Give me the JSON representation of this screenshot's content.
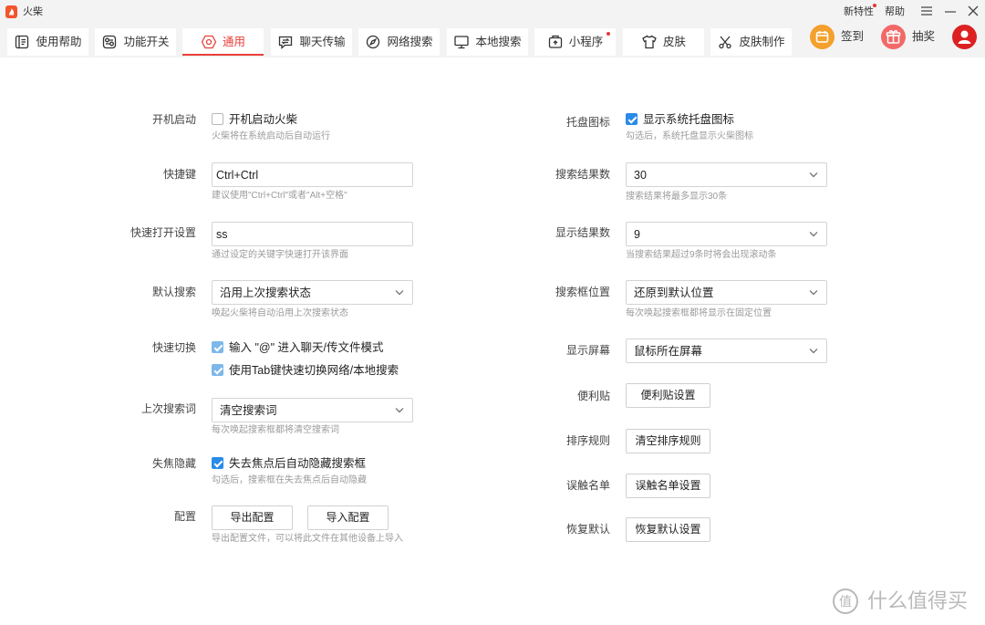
{
  "window": {
    "title": "火柴",
    "logo_icon": "huochai-logo-icon",
    "new_features": "新特性",
    "help": "帮助",
    "menu_icon": "menu-icon",
    "minimize_icon": "minimize-icon",
    "close_icon": "close-icon"
  },
  "tabs": [
    {
      "label": "使用帮助",
      "icon": "help-book-icon",
      "active": false
    },
    {
      "label": "功能开关",
      "icon": "feature-switch-icon",
      "active": false
    },
    {
      "label": "通用",
      "icon": "settings-hexagon-icon",
      "active": true
    },
    {
      "label": "聊天传输",
      "icon": "chat-transfer-icon",
      "active": false
    },
    {
      "label": "网络搜索",
      "icon": "compass-icon",
      "active": false
    },
    {
      "label": "本地搜索",
      "icon": "monitor-icon",
      "active": false
    },
    {
      "label": "小程序",
      "icon": "mini-program-icon",
      "active": false,
      "badge_dot": true
    },
    {
      "label": "皮肤",
      "icon": "tshirt-icon",
      "active": false
    },
    {
      "label": "皮肤制作",
      "icon": "skin-design-icon",
      "active": false
    }
  ],
  "actions": {
    "checkin": {
      "label": "签到",
      "icon": "checkin-icon"
    },
    "lottery": {
      "label": "抽奖",
      "icon": "gift-icon"
    },
    "avatar_icon": "user-avatar-icon"
  },
  "general_left": {
    "autostart": {
      "label": "开机启动",
      "checkbox": "开机启动火柴",
      "checked": false,
      "hint": "火柴将在系统启动后自动运行"
    },
    "hotkey": {
      "label": "快捷键",
      "value": "Ctrl+Ctrl",
      "hint": "建议使用\"Ctrl+Ctrl\"或者\"Alt+空格\""
    },
    "quick_open": {
      "label": "快速打开设置",
      "value": "ss",
      "hint": "通过设定的关键字快速打开该界面"
    },
    "default_search": {
      "label": "默认搜索",
      "selected": "沿用上次搜索状态",
      "hint": "唤起火柴将自动沿用上次搜索状态"
    },
    "quick_switch": {
      "label": "快速切换",
      "options": [
        {
          "text": "输入 \"@\" 进入聊天/传文件模式",
          "checked": true
        },
        {
          "text": "使用Tab键快速切换网络/本地搜索",
          "checked": true
        }
      ]
    },
    "last_query": {
      "label": "上次搜索词",
      "selected": "清空搜索词",
      "hint": "每次唤起搜索框都将清空搜索词"
    },
    "blur_hide": {
      "label": "失焦隐藏",
      "checkbox": "失去焦点后自动隐藏搜索框",
      "checked": true,
      "hint": "勾选后，搜索框在失去焦点后自动隐藏"
    },
    "config": {
      "label": "配置",
      "export_button": "导出配置",
      "import_button": "导入配置",
      "hint": "导出配置文件，可以将此文件在其他设备上导入"
    }
  },
  "general_right": {
    "tray_icon": {
      "label": "托盘图标",
      "checkbox": "显示系统托盘图标",
      "checked": true,
      "hint": "勾选后，系统托盘显示火柴图标"
    },
    "result_count": {
      "label": "搜索结果数",
      "selected": "30",
      "hint": "搜索结果将最多显示30条"
    },
    "visible_count": {
      "label": "显示结果数",
      "selected": "9",
      "hint": "当搜索结果超过9条时将会出现滚动条"
    },
    "search_position": {
      "label": "搜索框位置",
      "selected": "还原到默认位置",
      "hint": "每次唤起搜索框都将显示在固定位置"
    },
    "display_screen": {
      "label": "显示屏幕",
      "selected": "鼠标所在屏幕"
    },
    "sticky_note": {
      "label": "便利贴",
      "button": "便利贴设置"
    },
    "sort_rule": {
      "label": "排序规则",
      "button": "清空排序规则"
    },
    "mistouch_list": {
      "label": "误触名单",
      "button": "误触名单设置"
    },
    "restore_default": {
      "label": "恢复默认",
      "button": "恢复默认设置"
    }
  },
  "watermark": {
    "glyph": "值",
    "text": "什么值得买"
  },
  "colors": {
    "accent": "#e8403a",
    "badge_red": "#e53935",
    "checkbox_blue": "#2a8be8",
    "checkbox_soft_blue": "#7db8ea",
    "checkin_orange": "#f4a02c",
    "lottery_red": "#f36868",
    "avatar_red": "#dc2121",
    "watermark_gray": "#b9b9b9"
  }
}
